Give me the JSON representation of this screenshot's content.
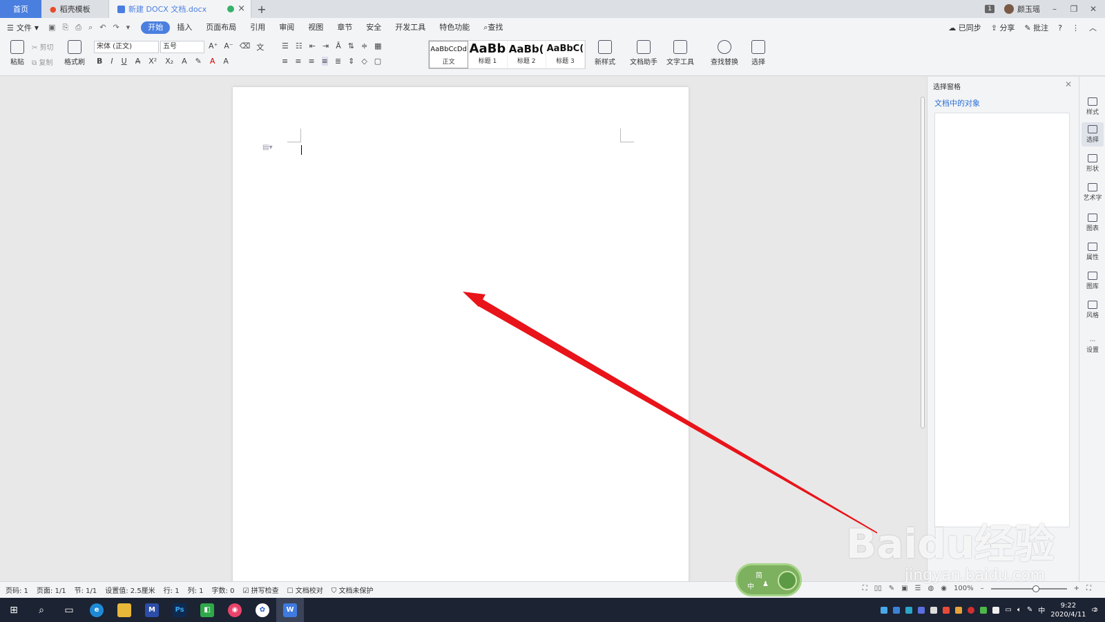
{
  "tabs": {
    "home": "首页",
    "template": "稻壳模板",
    "doc": "新建 DOCX 文档.docx",
    "plus": "+"
  },
  "window": {
    "badge": "1",
    "user": "颜玉瑶",
    "minimize": "–",
    "restore": "❐",
    "close": "✕"
  },
  "menu": {
    "file": "文件",
    "tabs": [
      "开始",
      "插入",
      "页面布局",
      "引用",
      "审阅",
      "视图",
      "章节",
      "安全",
      "开发工具",
      "特色功能"
    ],
    "find": "查找",
    "sync": "已同步",
    "share": "分享",
    "comment": "批注",
    "help": "?"
  },
  "ribbon": {
    "paste": "粘贴",
    "cut": "剪切",
    "copy": "复制",
    "format_painter": "格式刷",
    "font_name": "宋体 (正文)",
    "font_size": "五号",
    "bold": "B",
    "italic": "I",
    "underline": "U",
    "styles": [
      {
        "sample": "AaBbCcDd",
        "label": "正文"
      },
      {
        "sample": "AaBb",
        "label": "标题 1"
      },
      {
        "sample": "AaBb(",
        "label": "标题 2"
      },
      {
        "sample": "AaBbC(",
        "label": "标题 3"
      }
    ],
    "new_style": "新样式",
    "doc_assistant": "文档助手",
    "text_tools": "文字工具",
    "find_replace": "查找替换",
    "select": "选择"
  },
  "panel": {
    "title": "选择窗格",
    "subtitle": "文档中的对象"
  },
  "right_toolbar": [
    "样式",
    "选择",
    "形状",
    "艺术字",
    "图表",
    "属性",
    "图库",
    "风格",
    "设置"
  ],
  "status": {
    "page_num": "页码: 1",
    "pages": "页面: 1/1",
    "section": "节: 1/1",
    "position": "设置值: 2.5厘米",
    "row": "行: 1",
    "col": "列: 1",
    "words": "字数: 0",
    "spellcheck": "拼写检查",
    "proofread": "文档校对",
    "protect": "文档未保护",
    "zoom": "100%"
  },
  "ime": {
    "line1": "简",
    "line2": "中"
  },
  "taskbar": {
    "time": "9:22",
    "date": "2020/4/11",
    "lang": "中",
    "notif": "2"
  },
  "watermark": {
    "main": "Baidu经验",
    "sub": "jingyan.baidu.com"
  },
  "colors": {
    "accent": "#4a7fe0",
    "arrow": "#e8141a"
  }
}
